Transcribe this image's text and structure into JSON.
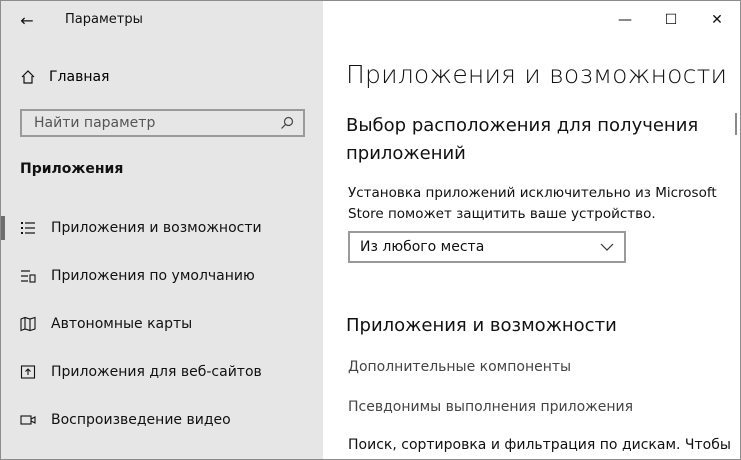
{
  "window": {
    "title": "Параметры",
    "controls": {
      "minimize": "—",
      "maximize": "☐",
      "close": "✕"
    }
  },
  "sidebar": {
    "home_label": "Главная",
    "search_placeholder": "Найти параметр",
    "section_title": "Приложения",
    "items": [
      {
        "label": "Приложения и возможности",
        "icon": "list-icon",
        "selected": true
      },
      {
        "label": "Приложения по умолчанию",
        "icon": "default-apps-icon",
        "selected": false
      },
      {
        "label": "Автономные карты",
        "icon": "map-icon",
        "selected": false
      },
      {
        "label": "Приложения для веб-сайтов",
        "icon": "web-app-icon",
        "selected": false
      },
      {
        "label": "Воспроизведение видео",
        "icon": "video-icon",
        "selected": false
      }
    ]
  },
  "main": {
    "title": "Приложения и возможности",
    "install_section_title": "Выбор расположения для получения приложений",
    "install_description": "Установка приложений исключительно из Microsoft Store поможет защитить ваше устройство.",
    "install_source_selected": "Из любого места",
    "apps_section_title": "Приложения и возможности",
    "links": [
      "Дополнительные компоненты",
      "Псевдонимы выполнения приложения"
    ],
    "partial_text": "Поиск, сортировка и фильтрация по дискам. Чтобы"
  }
}
